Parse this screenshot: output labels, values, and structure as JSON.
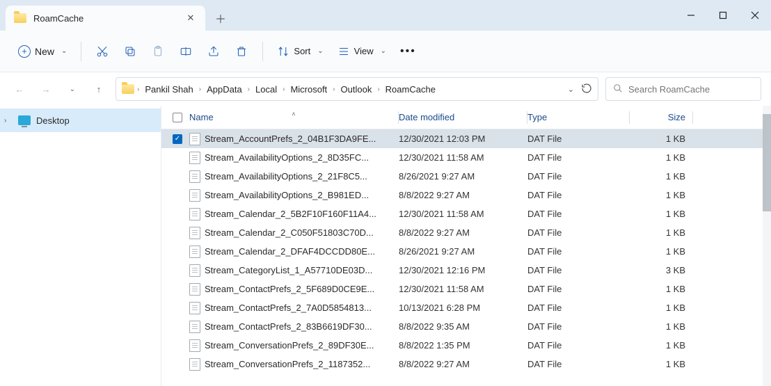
{
  "window": {
    "tab_title": "RoamCache"
  },
  "toolbar": {
    "new_label": "New",
    "sort_label": "Sort",
    "view_label": "View"
  },
  "nav": {
    "breadcrumb": [
      "Pankil Shah",
      "AppData",
      "Local",
      "Microsoft",
      "Outlook",
      "RoamCache"
    ]
  },
  "search": {
    "placeholder": "Search RoamCache"
  },
  "sidebar": {
    "item0": "Desktop"
  },
  "columns": {
    "name": "Name",
    "date": "Date modified",
    "type": "Type",
    "size": "Size"
  },
  "files": [
    {
      "selected": true,
      "name": "Stream_AccountPrefs_2_04B1F3DA9FE...",
      "date": "12/30/2021 12:03 PM",
      "type": "DAT File",
      "size": "1 KB"
    },
    {
      "selected": false,
      "name": "Stream_AvailabilityOptions_2_8D35FC...",
      "date": "12/30/2021 11:58 AM",
      "type": "DAT File",
      "size": "1 KB"
    },
    {
      "selected": false,
      "name": "Stream_AvailabilityOptions_2_21F8C5...",
      "date": "8/26/2021 9:27 AM",
      "type": "DAT File",
      "size": "1 KB"
    },
    {
      "selected": false,
      "name": "Stream_AvailabilityOptions_2_B981ED...",
      "date": "8/8/2022 9:27 AM",
      "type": "DAT File",
      "size": "1 KB"
    },
    {
      "selected": false,
      "name": "Stream_Calendar_2_5B2F10F160F11A4...",
      "date": "12/30/2021 11:58 AM",
      "type": "DAT File",
      "size": "1 KB"
    },
    {
      "selected": false,
      "name": "Stream_Calendar_2_C050F51803C70D...",
      "date": "8/8/2022 9:27 AM",
      "type": "DAT File",
      "size": "1 KB"
    },
    {
      "selected": false,
      "name": "Stream_Calendar_2_DFAF4DCCDD80E...",
      "date": "8/26/2021 9:27 AM",
      "type": "DAT File",
      "size": "1 KB"
    },
    {
      "selected": false,
      "name": "Stream_CategoryList_1_A57710DE03D...",
      "date": "12/30/2021 12:16 PM",
      "type": "DAT File",
      "size": "3 KB"
    },
    {
      "selected": false,
      "name": "Stream_ContactPrefs_2_5F689D0CE9E...",
      "date": "12/30/2021 11:58 AM",
      "type": "DAT File",
      "size": "1 KB"
    },
    {
      "selected": false,
      "name": "Stream_ContactPrefs_2_7A0D5854813...",
      "date": "10/13/2021 6:28 PM",
      "type": "DAT File",
      "size": "1 KB"
    },
    {
      "selected": false,
      "name": "Stream_ContactPrefs_2_83B6619DF30...",
      "date": "8/8/2022 9:35 AM",
      "type": "DAT File",
      "size": "1 KB"
    },
    {
      "selected": false,
      "name": "Stream_ConversationPrefs_2_89DF30E...",
      "date": "8/8/2022 1:35 PM",
      "type": "DAT File",
      "size": "1 KB"
    },
    {
      "selected": false,
      "name": "Stream_ConversationPrefs_2_1187352...",
      "date": "8/8/2022 9:27 AM",
      "type": "DAT File",
      "size": "1 KB"
    }
  ]
}
